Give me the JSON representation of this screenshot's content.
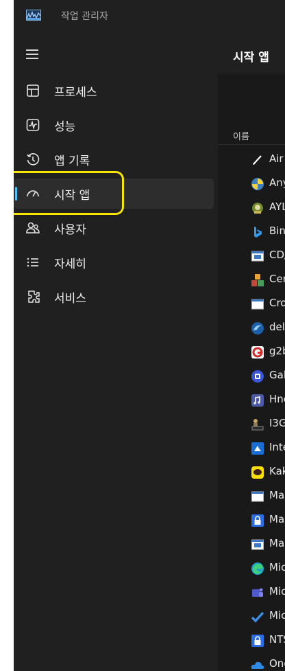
{
  "window": {
    "title": "작업 관리자",
    "app_icon": "task-manager-icon"
  },
  "nav": {
    "menu_icon": "hamburger-menu-icon",
    "items": [
      {
        "label": "프로세스",
        "icon": "processes-icon"
      },
      {
        "label": "성능",
        "icon": "performance-icon"
      },
      {
        "label": "앱 기록",
        "icon": "app-history-icon"
      },
      {
        "label": "시작 앱",
        "icon": "startup-apps-icon",
        "active": true
      },
      {
        "label": "사용자",
        "icon": "users-icon"
      },
      {
        "label": "자세히",
        "icon": "details-icon"
      },
      {
        "label": "서비스",
        "icon": "services-icon"
      }
    ]
  },
  "annotation": {
    "color": "#f5e500"
  },
  "colors": {
    "accent": "#4cc2ff",
    "background": "#202020",
    "content_background": "#191919"
  },
  "main": {
    "title": "시작 앱",
    "column_name": "이름",
    "rows": [
      {
        "label": "Air",
        "icon": "pen-icon"
      },
      {
        "label": "Any",
        "icon": "python-icon"
      },
      {
        "label": "AYL",
        "icon": "ayl-icon"
      },
      {
        "label": "Bin",
        "icon": "bing-icon"
      },
      {
        "label": "CD/",
        "icon": "window-app-icon"
      },
      {
        "label": "Cer",
        "icon": "certificate-icon"
      },
      {
        "label": "Cro",
        "icon": "blank-window-icon"
      },
      {
        "label": "del",
        "icon": "dolphin-icon"
      },
      {
        "label": "g2b",
        "icon": "g2b-icon"
      },
      {
        "label": "Gal",
        "icon": "galaxy-icon"
      },
      {
        "label": "Hnc",
        "icon": "hnc-icon"
      },
      {
        "label": "I3G",
        "icon": "i3g-icon"
      },
      {
        "label": "Inte",
        "icon": "intel-icon"
      },
      {
        "label": "Kak",
        "icon": "kakaotalk-icon"
      },
      {
        "label": "Ma",
        "icon": "blank-window-icon"
      },
      {
        "label": "Ma",
        "icon": "lock-icon"
      },
      {
        "label": "Ma",
        "icon": "window-app-icon"
      },
      {
        "label": "Mic",
        "icon": "edge-icon"
      },
      {
        "label": "Mic",
        "icon": "teams-icon"
      },
      {
        "label": "Mic",
        "icon": "todo-check-icon"
      },
      {
        "label": "NTS",
        "icon": "lock-icon"
      },
      {
        "label": "One",
        "icon": "onedrive-icon"
      }
    ]
  }
}
